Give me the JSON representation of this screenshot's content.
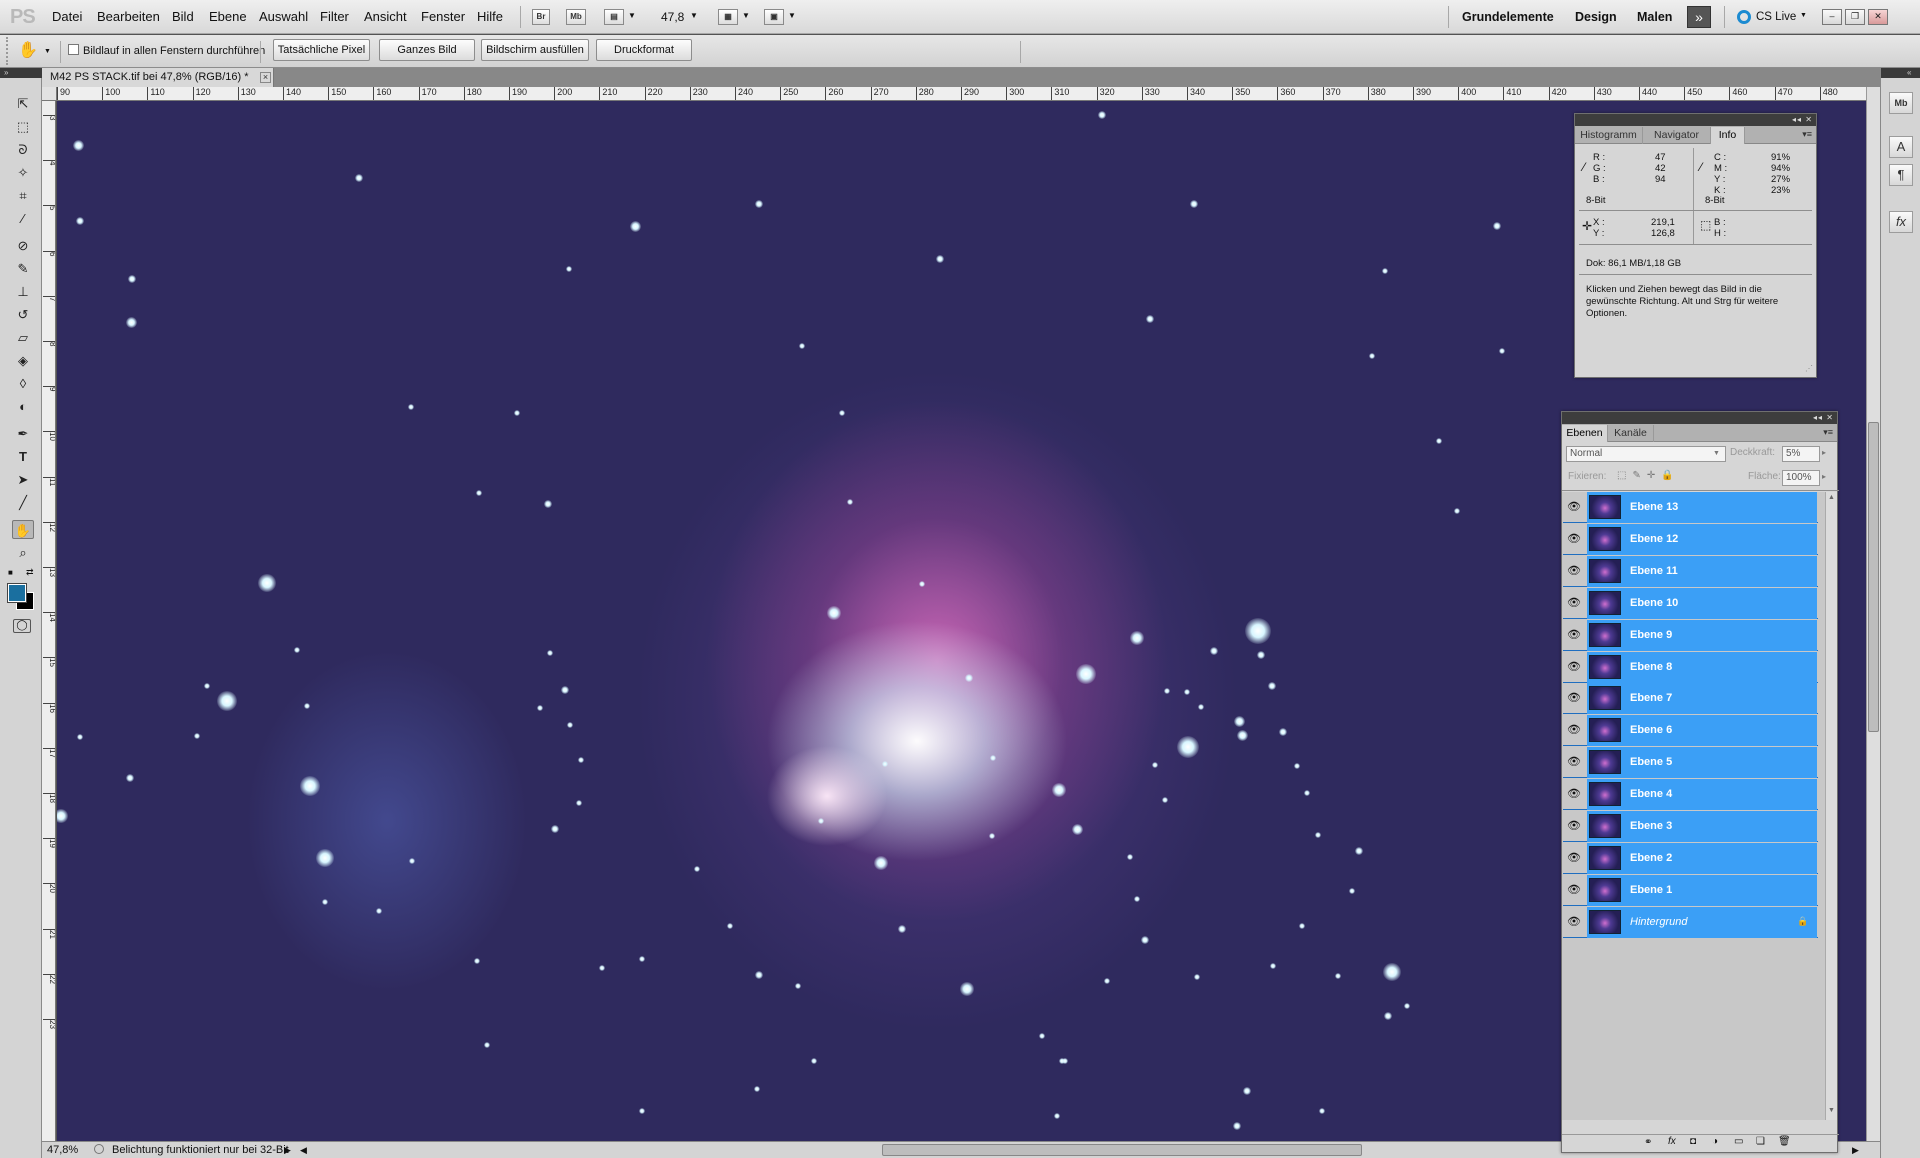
{
  "app": {
    "logo": "PS"
  },
  "menu": [
    "Datei",
    "Bearbeiten",
    "Bild",
    "Ebene",
    "Auswahl",
    "Filter",
    "Ansicht",
    "Fenster",
    "Hilfe"
  ],
  "appbar": {
    "bridge": "Br",
    "minibridge": "Mb",
    "zoom": "47,8"
  },
  "workspaces": [
    "Grundelemente",
    "Design",
    "Malen"
  ],
  "cslive": "CS Live",
  "options": {
    "scroll_all_label": "Bildlauf in allen Fenstern durchführen",
    "buttons": [
      "Tatsächliche Pixel",
      "Ganzes Bild",
      "Bildschirm ausfüllen",
      "Druckformat"
    ]
  },
  "document": {
    "tab_title": "M42 PS STACK.tif bei 47,8% (RGB/16) *"
  },
  "ruler_h": [
    "90",
    "100",
    "110",
    "120",
    "130",
    "140",
    "150",
    "160",
    "170",
    "180",
    "190",
    "200",
    "210",
    "220",
    "230",
    "240",
    "250",
    "260",
    "270",
    "280",
    "290",
    "300",
    "310",
    "320",
    "330",
    "340",
    "350",
    "360",
    "370",
    "380",
    "390",
    "400",
    "410",
    "420",
    "430",
    "440",
    "450",
    "460",
    "470",
    "480"
  ],
  "ruler_v": [
    "3",
    "4",
    "5",
    "6",
    "7",
    "8",
    "9",
    "10",
    "11",
    "12",
    "13",
    "14",
    "15",
    "16",
    "17",
    "18",
    "19",
    "20",
    "21",
    "22",
    "23"
  ],
  "status": {
    "zoom": "47,8%",
    "message": "Belichtung funktioniert nur bei 32-Bit"
  },
  "info_panel": {
    "tabs": [
      "Histogramm",
      "Navigator",
      "Info"
    ],
    "rgb": [
      {
        "l": "R :",
        "v": "47"
      },
      {
        "l": "G :",
        "v": "42"
      },
      {
        "l": "B :",
        "v": "94"
      }
    ],
    "cmyk": [
      {
        "l": "C :",
        "v": "91%"
      },
      {
        "l": "M :",
        "v": "94%"
      },
      {
        "l": "Y :",
        "v": "27%"
      },
      {
        "l": "K :",
        "v": "23%"
      }
    ],
    "bit_left": "8-Bit",
    "bit_right": "8-Bit",
    "xy": [
      {
        "l": "X :",
        "v": "219,1"
      },
      {
        "l": "Y :",
        "v": "126,8"
      }
    ],
    "bh": [
      {
        "l": "B :"
      },
      {
        "l": "H :"
      }
    ],
    "doc": "Dok: 86,1 MB/1,18 GB",
    "hint": [
      "Klicken und Ziehen bewegt das Bild in die",
      "gewünschte Richtung. Alt und Strg für weitere",
      "Optionen."
    ]
  },
  "layers_panel": {
    "tabs": [
      "Ebenen",
      "Kanäle"
    ],
    "blend_mode": "Normal",
    "opacity_label": "Deckkraft:",
    "opacity": "5%",
    "lock_label": "Fixieren:",
    "fill_label": "Fläche:",
    "fill": "100%",
    "layers": [
      "Ebene 13",
      "Ebene 12",
      "Ebene 11",
      "Ebene 10",
      "Ebene 9",
      "Ebene 8",
      "Ebene 7",
      "Ebene 6",
      "Ebene 5",
      "Ebene 4",
      "Ebene 3",
      "Ebene 2",
      "Ebene 1",
      "Hintergrund"
    ]
  },
  "colors": {
    "canvas_bg": "#2f2a5e",
    "selection": "#3b9ff6",
    "foreground": "#1a6f9f",
    "background": "#000000"
  }
}
